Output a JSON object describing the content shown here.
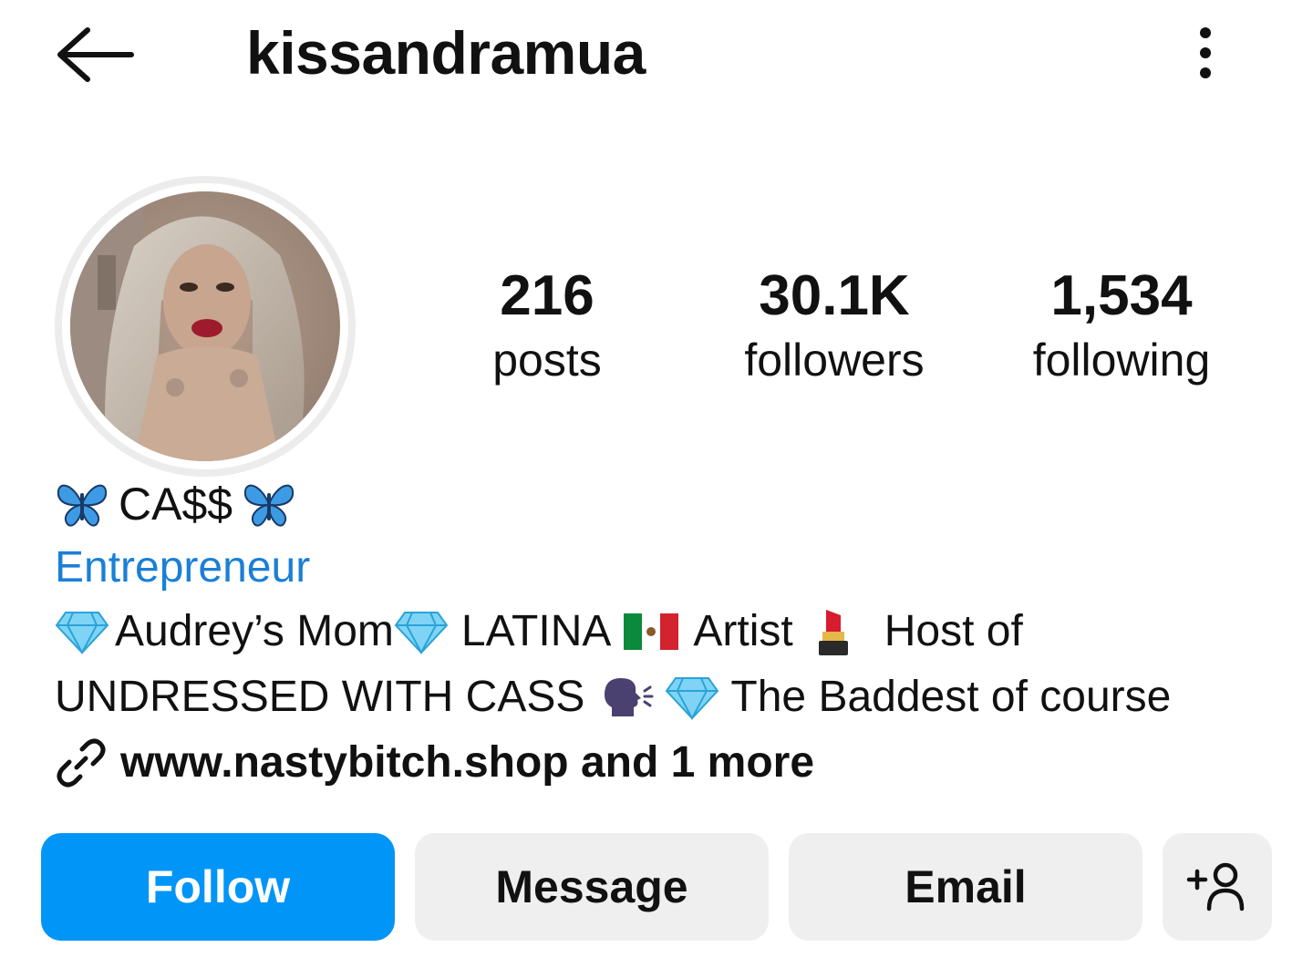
{
  "header": {
    "username": "kissandramua",
    "back_icon": "arrow-left-icon",
    "more_icon": "more-vertical-icon"
  },
  "profile": {
    "avatar_icon": "profile-photo",
    "stats": [
      {
        "value": "216",
        "label": "posts"
      },
      {
        "value": "30.1K",
        "label": "followers"
      },
      {
        "value": "1,534",
        "label": "following"
      }
    ],
    "display_name": "CA$$",
    "category": "Entrepreneur",
    "bio": {
      "line1": {
        "part1": "Audrey’s Mom",
        "part2": "LATINA",
        "part3": "Artist",
        "part4": "Host of"
      },
      "line2": {
        "part1": "UNDRESSED WITH CASS",
        "part2": "The Baddest of course"
      }
    },
    "link": "www.nastybitch.shop and 1 more"
  },
  "actions": {
    "follow": "Follow",
    "message": "Message",
    "email": "Email",
    "add_user_icon": "add-person-icon"
  },
  "colors": {
    "follow_bg": "#0095f6",
    "category": "#1b7fd6",
    "secondary_btn_bg": "#efefef"
  }
}
